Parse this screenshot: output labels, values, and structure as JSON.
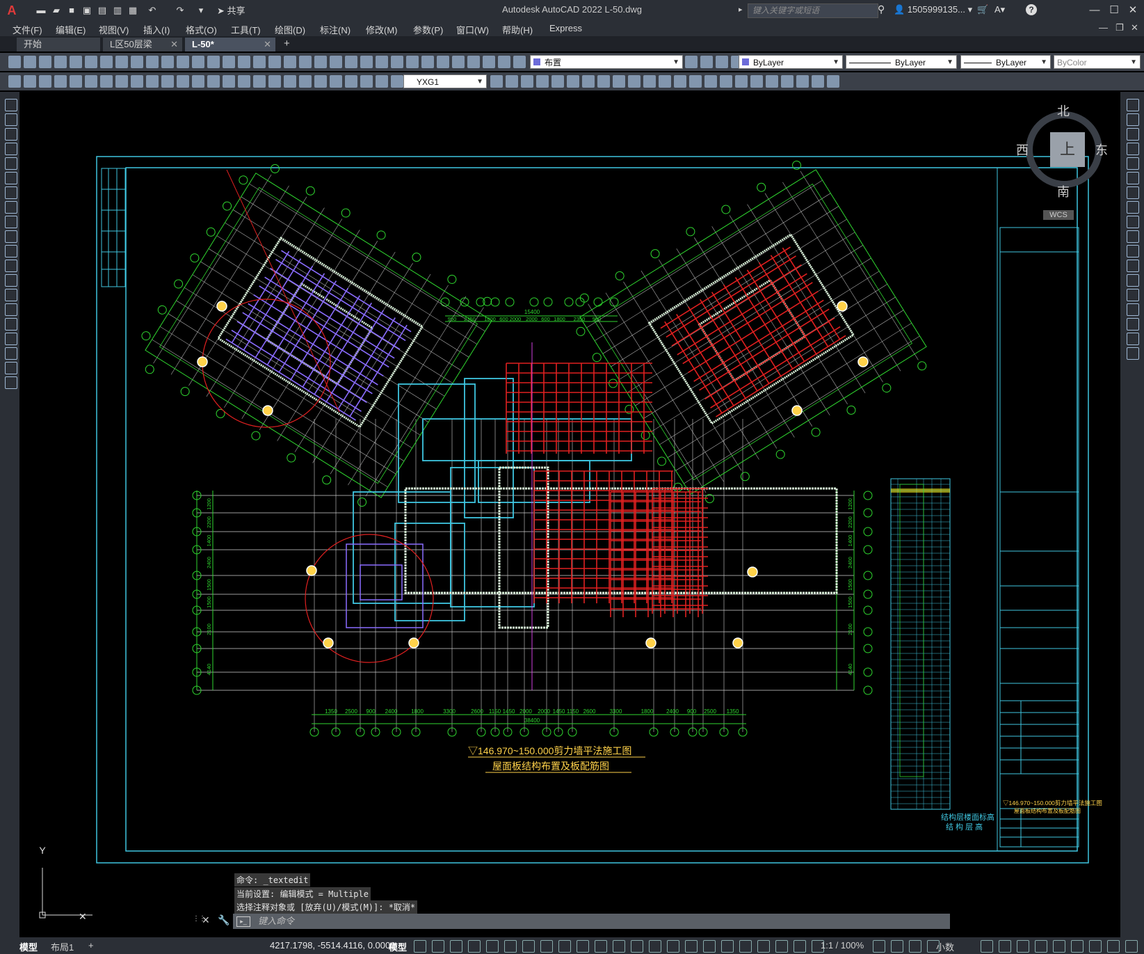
{
  "titlebar": {
    "app_title": "Autodesk AutoCAD 2022    L-50.dwg",
    "share_label": "共享",
    "search_placeholder": "键入关键字或短语",
    "user_name": "1505999135...",
    "logo": "A"
  },
  "menu": [
    "文件(F)",
    "编辑(E)",
    "视图(V)",
    "插入(I)",
    "格式(O)",
    "工具(T)",
    "绘图(D)",
    "标注(N)",
    "修改(M)",
    "参数(P)",
    "窗口(W)",
    "帮助(H)",
    "Express"
  ],
  "tabs": [
    {
      "label": "开始",
      "closable": false
    },
    {
      "label": "L区50层梁",
      "closable": true
    },
    {
      "label": "L-50*",
      "closable": true,
      "active": true
    }
  ],
  "add_tab": "+",
  "toolbar": {
    "layer_name": "布置",
    "color": "ByLayer",
    "linetype": "ByLayer",
    "lineweight": "ByLayer",
    "plotstyle": "ByColor",
    "textstyle": "YXG1"
  },
  "viewcube": {
    "north": "北",
    "south": "南",
    "east": "东",
    "west": "西",
    "face": "上",
    "wcs": "WCS"
  },
  "drawing": {
    "title_main": "▽146.970~150.000剪力墙平法施工图",
    "title_sub": "屋面板结构布置及板配筋图",
    "titleblock_title": "▽146.970~150.000剪力墙平法施工图",
    "titleblock_sub": "屋面板结构布置及板配筋图",
    "elev_table_title": "结构层楼面标高",
    "elev_table_sub": "结 构 层 高",
    "bottom_dims": [
      "1350",
      "2500",
      "900",
      "2400",
      "1800",
      "3300",
      "2600",
      "1150",
      "1450",
      "2000",
      "2000",
      "1450",
      "1150",
      "2600",
      "3300",
      "1800",
      "2400",
      "900",
      "2500",
      "1350"
    ],
    "total_dim": "38400",
    "top_dims": [
      "950",
      "2350",
      "1800",
      "600",
      "2000",
      "2000",
      "600",
      "1800",
      "2350",
      "950"
    ],
    "top_total": "15400",
    "left_dims": [
      "1200",
      "2200",
      "1400",
      "2400",
      "1500",
      "1500",
      "2100",
      "4140"
    ],
    "ucs_y": "Y"
  },
  "command": {
    "history": [
      "命令: _textedit",
      "当前设置: 编辑模式 = Multiple",
      "选择注释对象或 [放弃(U)/模式(M)]: *取消*"
    ],
    "placeholder": "键入命令"
  },
  "statusbar": {
    "tabs": [
      "模型",
      "布局1"
    ],
    "coords": "4217.1798, -5514.4116, 0.0000",
    "model_label": "模型",
    "scale": "1:1 / 100%",
    "units": "小数"
  }
}
